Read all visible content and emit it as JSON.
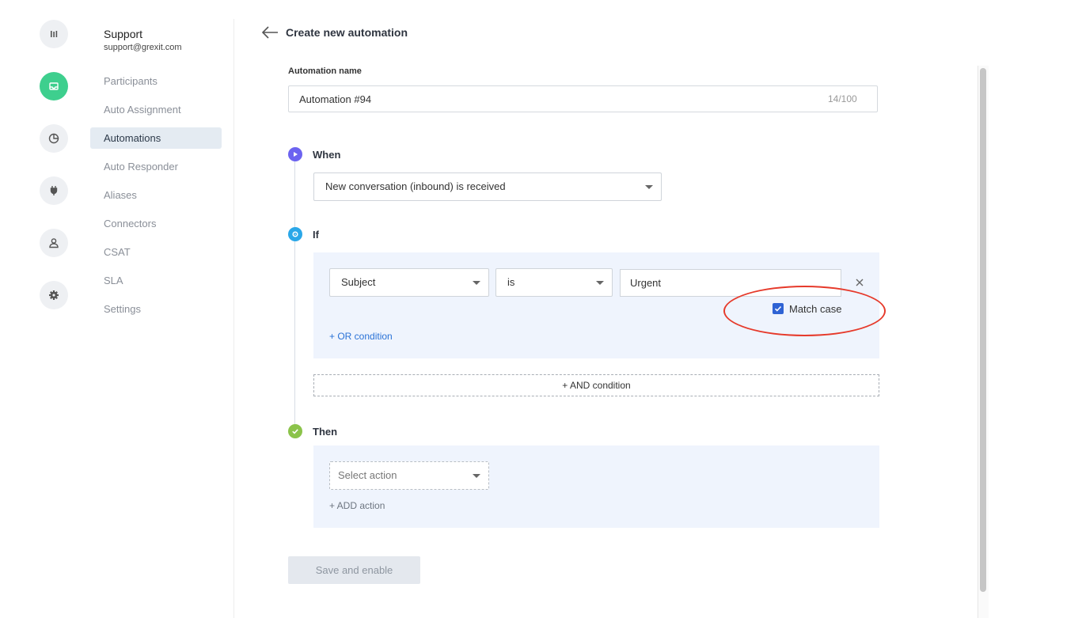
{
  "rail": {
    "items": [
      {
        "icon": "bar-chart-icon"
      },
      {
        "icon": "inbox-icon",
        "active": true
      },
      {
        "icon": "pie-chart-icon"
      },
      {
        "icon": "plug-icon"
      },
      {
        "icon": "user-icon"
      },
      {
        "icon": "gear-icon"
      }
    ]
  },
  "sidebar": {
    "workspace_name": "Support",
    "workspace_email": "support@grexit.com",
    "items": [
      {
        "label": "Participants"
      },
      {
        "label": "Auto Assignment"
      },
      {
        "label": "Automations",
        "active": true
      },
      {
        "label": "Auto Responder"
      },
      {
        "label": "Aliases"
      },
      {
        "label": "Connectors"
      },
      {
        "label": "CSAT"
      },
      {
        "label": "SLA"
      },
      {
        "label": "Settings"
      }
    ]
  },
  "header": {
    "title": "Create new automation"
  },
  "form": {
    "name_label": "Automation name",
    "name_value": "Automation #94",
    "name_counter": "14/100",
    "when": {
      "label": "When",
      "trigger": "New conversation (inbound) is received"
    },
    "if": {
      "label": "If",
      "field": "Subject",
      "operator": "is",
      "value": "Urgent",
      "match_case_label": "Match case",
      "match_case_checked": true,
      "or_condition": "+ OR condition",
      "and_condition": "+ AND condition"
    },
    "then": {
      "label": "Then",
      "action_placeholder": "Select action",
      "add_action": "+ ADD action"
    },
    "save_label": "Save and enable"
  },
  "colors": {
    "accent_green": "#3ecf8e",
    "when_dot": "#6c63f0",
    "if_dot": "#2aa7e8",
    "then_dot": "#8bc34a",
    "link_blue": "#2a72d6",
    "highlight_red": "#e63a2b"
  }
}
